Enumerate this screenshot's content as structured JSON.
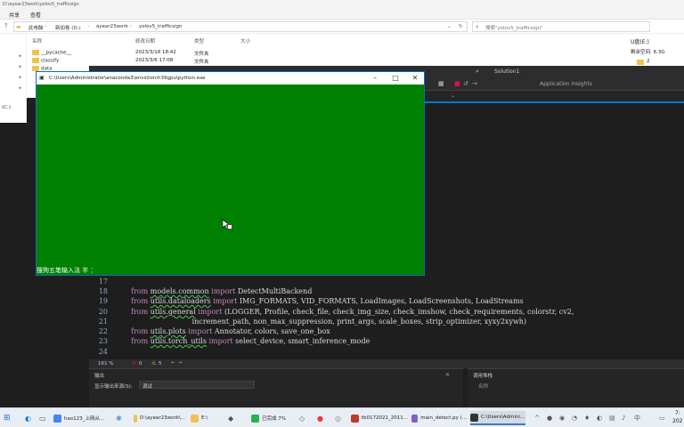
{
  "explorer": {
    "title": "D:\\ayear23work\\yolov5_trafficsign",
    "ribbon_tabs": [
      "共享",
      "查看"
    ],
    "breadcrumb": [
      "此电脑",
      "新加卷 (D:)",
      "ayear23work",
      "yolov5_trafficsign"
    ],
    "search_placeholder": "搜索\"yolov5_trafficsign\"",
    "columns": [
      "名称",
      "修改日期",
      "类型",
      "大小"
    ],
    "files": [
      {
        "name": "__pycache__",
        "date": "2023/3/18 18:42",
        "type": "文件夹"
      },
      {
        "name": "classify",
        "date": "2023/3/6 17:08",
        "type": "文件夹"
      },
      {
        "name": "data",
        "date": "",
        "type": ""
      }
    ],
    "sidebar_label": "(C:)",
    "drive_label": "U盘(E:)",
    "drive_free": "剩余空间: 6.3G",
    "drive_folder": "2"
  },
  "vs": {
    "solution": "Solution1",
    "insights": "Application Insights",
    "zoom": "161 %",
    "errors": "0",
    "warnings": "5",
    "output_title": "输出",
    "output_source_label": "显示输出来源(S):",
    "output_source_value": "调试",
    "callstack_title": "调用堆栈",
    "callstack_col": "名称",
    "code_lines": [
      {
        "num": "17",
        "segs": []
      },
      {
        "num": "18",
        "segs": [
          {
            "t": "from ",
            "c": "kw"
          },
          {
            "t": "models.common",
            "c": "mod"
          },
          {
            "t": " import ",
            "c": "kw"
          },
          {
            "t": "DetectMultiBackend",
            "c": ""
          }
        ]
      },
      {
        "num": "19",
        "segs": [
          {
            "t": "from ",
            "c": "kw"
          },
          {
            "t": "utils.dataloaders",
            "c": "mod"
          },
          {
            "t": " import ",
            "c": "kw"
          },
          {
            "t": "IMG_FORMATS, VID_FORMATS, LoadImages, LoadScreenshots, LoadStreams",
            "c": ""
          }
        ]
      },
      {
        "num": "20",
        "segs": [
          {
            "t": "from ",
            "c": "kw"
          },
          {
            "t": "utils.general",
            "c": "mod"
          },
          {
            "t": " import ",
            "c": "kw"
          },
          {
            "t": "(LOGGER, Profile, check_file, check_img_size, check_imshow, check_requirements, colorstr, cv2,",
            "c": ""
          }
        ]
      },
      {
        "num": "21",
        "segs": [
          {
            "t": "                           increment_path, non_max_suppression, print_args, scale_boxes, strip_optimizer, xyxy2xywh)",
            "c": ""
          }
        ]
      },
      {
        "num": "22",
        "segs": [
          {
            "t": "from ",
            "c": "kw"
          },
          {
            "t": "utils.plots",
            "c": "mod"
          },
          {
            "t": " import ",
            "c": "kw"
          },
          {
            "t": "Annotator, colors, save_one_box",
            "c": ""
          }
        ]
      },
      {
        "num": "23",
        "segs": [
          {
            "t": "from ",
            "c": "kw"
          },
          {
            "t": "utils.torch_utils",
            "c": "mod"
          },
          {
            "t": " import ",
            "c": "kw"
          },
          {
            "t": "select_device, smart_inference_mode",
            "c": ""
          }
        ]
      },
      {
        "num": "24",
        "segs": []
      }
    ]
  },
  "console": {
    "title": "C:\\Users\\Administrator\\anaconda3\\envs\\torch39gpu\\python.exe",
    "background": "#008000",
    "ime_status": "搜狗五笔输入法 半 ："
  },
  "taskbar": {
    "items": [
      "hao123_上网从...",
      "D:\\ayear23work\\...",
      "E:\\",
      "已完成 7%",
      "tb0172021_2011...",
      "main_detect.py (...",
      "C:\\Users\\Admini..."
    ],
    "time": "7:",
    "date": "202"
  }
}
